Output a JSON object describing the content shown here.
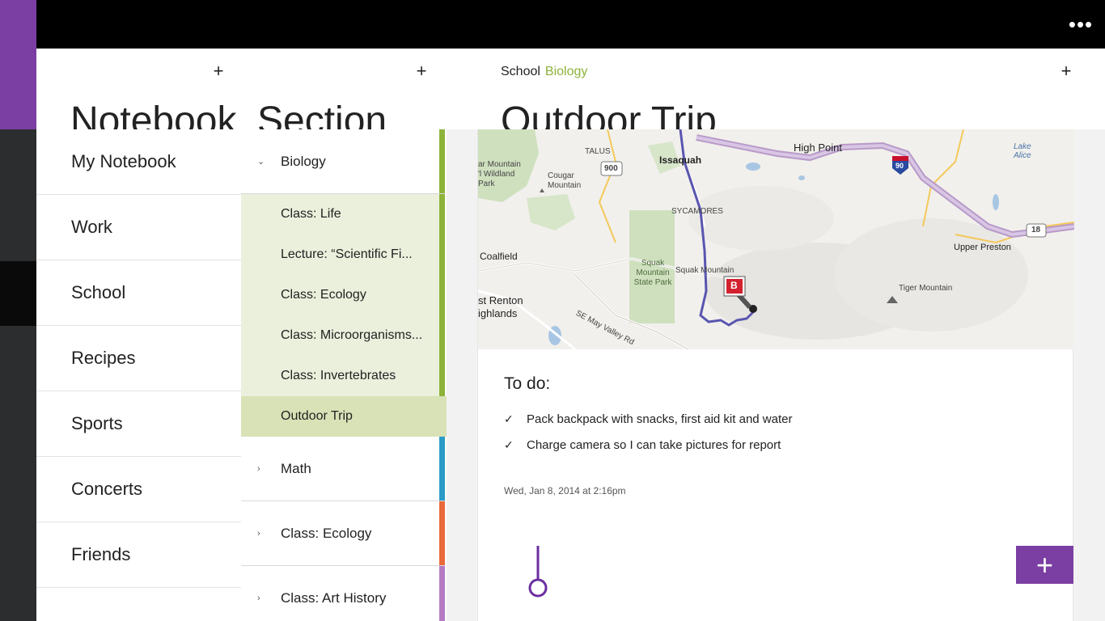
{
  "topbar": {
    "more_label": "•••"
  },
  "notebooks": {
    "title": "Notebook",
    "add_label": "+",
    "items": [
      {
        "label": "My Notebook"
      },
      {
        "label": "Work"
      },
      {
        "label": "School"
      },
      {
        "label": "Recipes"
      },
      {
        "label": "Sports"
      },
      {
        "label": "Concerts"
      },
      {
        "label": "Friends"
      }
    ],
    "selected": "School"
  },
  "sections": {
    "title": "Section",
    "add_label": "+",
    "groups": [
      {
        "label": "Biology",
        "chevron": "⌄",
        "color": "#8db33a",
        "expanded": true,
        "pages": [
          {
            "label": "Class: Life"
          },
          {
            "label": "Lecture: “Scientific  Fi..."
          },
          {
            "label": "Class: Ecology"
          },
          {
            "label": "Class: Microorganisms..."
          },
          {
            "label": "Class: Invertebrates"
          },
          {
            "label": "Outdoor Trip"
          }
        ]
      },
      {
        "label": "Math",
        "chevron": "›",
        "color": "#2a9bc6"
      },
      {
        "label": "Class: Ecology",
        "chevron": "›",
        "color": "#e86a3a"
      },
      {
        "label": "Class: Art History",
        "chevron": "›",
        "color": "#b57cc4"
      }
    ]
  },
  "page": {
    "breadcrumb_notebook": "School",
    "breadcrumb_section": "Biology",
    "title": "Outdoor Trip",
    "add_label": "+",
    "map_labels": {
      "issaquah": "Issaquah",
      "talus": "TALUS",
      "highpoint": "High Point",
      "lakealice": "Lake Alice",
      "cougar": "Cougar Mountain",
      "park": "ar Mountain\n'l Wildland\nPark",
      "sycamores": "SYCAMORES",
      "upperpreston": "Upper Preston",
      "coalfield": "Coalfield",
      "squakpark": "Squak Mountain State Park",
      "squakmtn": "Squak Mountain",
      "tiger": "Tiger Mountain",
      "renton": "st Renton ighlands",
      "maypass": "SE May Valley Rd",
      "r900": "900",
      "r90": "90",
      "r18": "18",
      "marker": "B"
    },
    "todo_title": "To do:",
    "todos": [
      {
        "label": "Pack backpack with snacks, first aid kit and water",
        "check": "✓"
      },
      {
        "label": "Charge camera so I can take pictures for report",
        "check": "✓"
      }
    ],
    "timestamp": "Wed, Jan 8, 2014 at 2:16pm",
    "fab_label": "+"
  },
  "colors": {
    "accent": "#7b3fa3",
    "biology": "#8db33a",
    "math": "#2a9bc6",
    "ecology": "#e86a3a",
    "arthistory": "#b57cc4"
  }
}
